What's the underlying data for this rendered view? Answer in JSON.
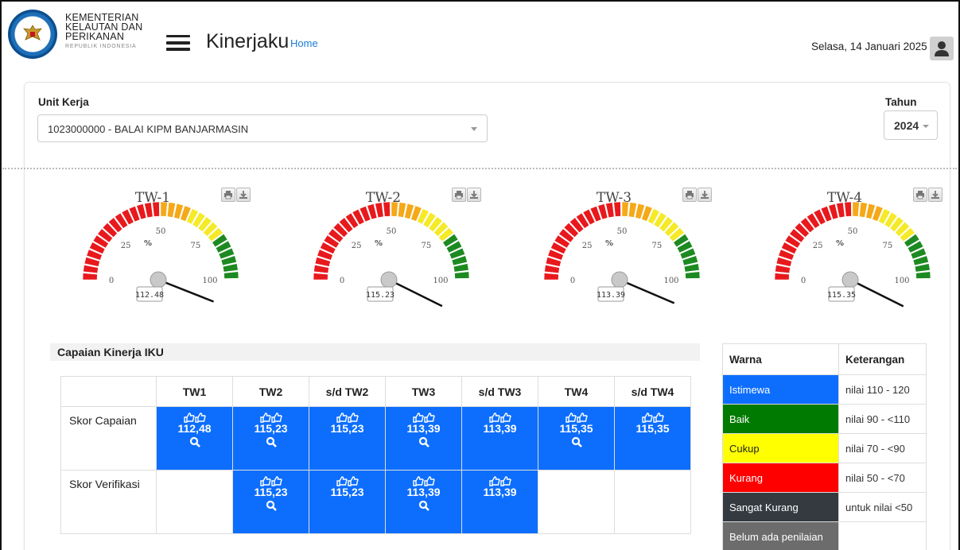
{
  "header": {
    "org_line1": "KEMENTERIAN",
    "org_line2": "KELAUTAN DAN",
    "org_line3": "PERIKANAN",
    "org_sub": "REPUBLIK INDONESIA",
    "app_title": "Kinerjaku",
    "home_link": "Home",
    "date": "Selasa, 14 Januari 2025",
    "menu_icon": "hamburger-icon",
    "user_icon": "user-icon"
  },
  "filters": {
    "unit_label": "Unit Kerja",
    "unit_value": "1023000000 - BALAI KIPM BANJARMASIN",
    "year_label": "Tahun",
    "year_value": "2024"
  },
  "gauges": [
    {
      "title": "TW-1",
      "value": 112.48,
      "value_text": "112.48"
    },
    {
      "title": "TW-2",
      "value": 115.23,
      "value_text": "115.23"
    },
    {
      "title": "TW-3",
      "value": 113.39,
      "value_text": "113.39"
    },
    {
      "title": "TW-4",
      "value": 115.35,
      "value_text": "115.35"
    }
  ],
  "gauge_scale": {
    "min": 0,
    "max": 100,
    "ticks": [
      "0",
      "25",
      "50",
      "75",
      "100"
    ],
    "unit": "%"
  },
  "gauge_colors": {
    "red": "#e8191d",
    "orange": "#f5a818",
    "yellow": "#f5ea28",
    "green": "#1d8a21"
  },
  "iku": {
    "title": "Capaian Kinerja IKU",
    "columns": [
      "",
      "TW1",
      "TW2",
      "s/d TW2",
      "TW3",
      "s/d TW3",
      "TW4",
      "s/d TW4"
    ],
    "rows": [
      {
        "label": "Skor Capaian",
        "cells": [
          {
            "value": "112,48",
            "zoom": true
          },
          {
            "value": "115,23",
            "zoom": true
          },
          {
            "value": "115,23",
            "zoom": false
          },
          {
            "value": "113,39",
            "zoom": true
          },
          {
            "value": "113,39",
            "zoom": false
          },
          {
            "value": "115,35",
            "zoom": true
          },
          {
            "value": "115,35",
            "zoom": false
          }
        ]
      },
      {
        "label": "Skor Verifikasi",
        "cells": [
          null,
          {
            "value": "115,23",
            "zoom": true
          },
          {
            "value": "115,23",
            "zoom": false
          },
          {
            "value": "113,39",
            "zoom": true
          },
          {
            "value": "113,39",
            "zoom": false
          },
          null,
          null
        ]
      }
    ],
    "cell_color": "#0d6efd"
  },
  "legend": {
    "headers": [
      "Warna",
      "Keterangan"
    ],
    "rows": [
      {
        "name": "Istimewa",
        "desc": "nilai 110 - 120",
        "color": "#0d6efd",
        "text_color": "#ffffff"
      },
      {
        "name": "Baik",
        "desc": "nilai 90 - <110",
        "color": "#007a00",
        "text_color": "#ffffff"
      },
      {
        "name": "Cukup",
        "desc": "nilai 70 - <90",
        "color": "#ffff00",
        "text_color": "#222222"
      },
      {
        "name": "Kurang",
        "desc": "nilai 50 - <70",
        "color": "#ff0000",
        "text_color": "#ffffff"
      },
      {
        "name": "Sangat Kurang",
        "desc": "untuk nilai <50",
        "color": "#343a40",
        "text_color": "#ffffff"
      },
      {
        "name": "Belum ada penilaian",
        "desc": "",
        "color": "#6c6c6c",
        "text_color": "#ffffff"
      }
    ]
  }
}
